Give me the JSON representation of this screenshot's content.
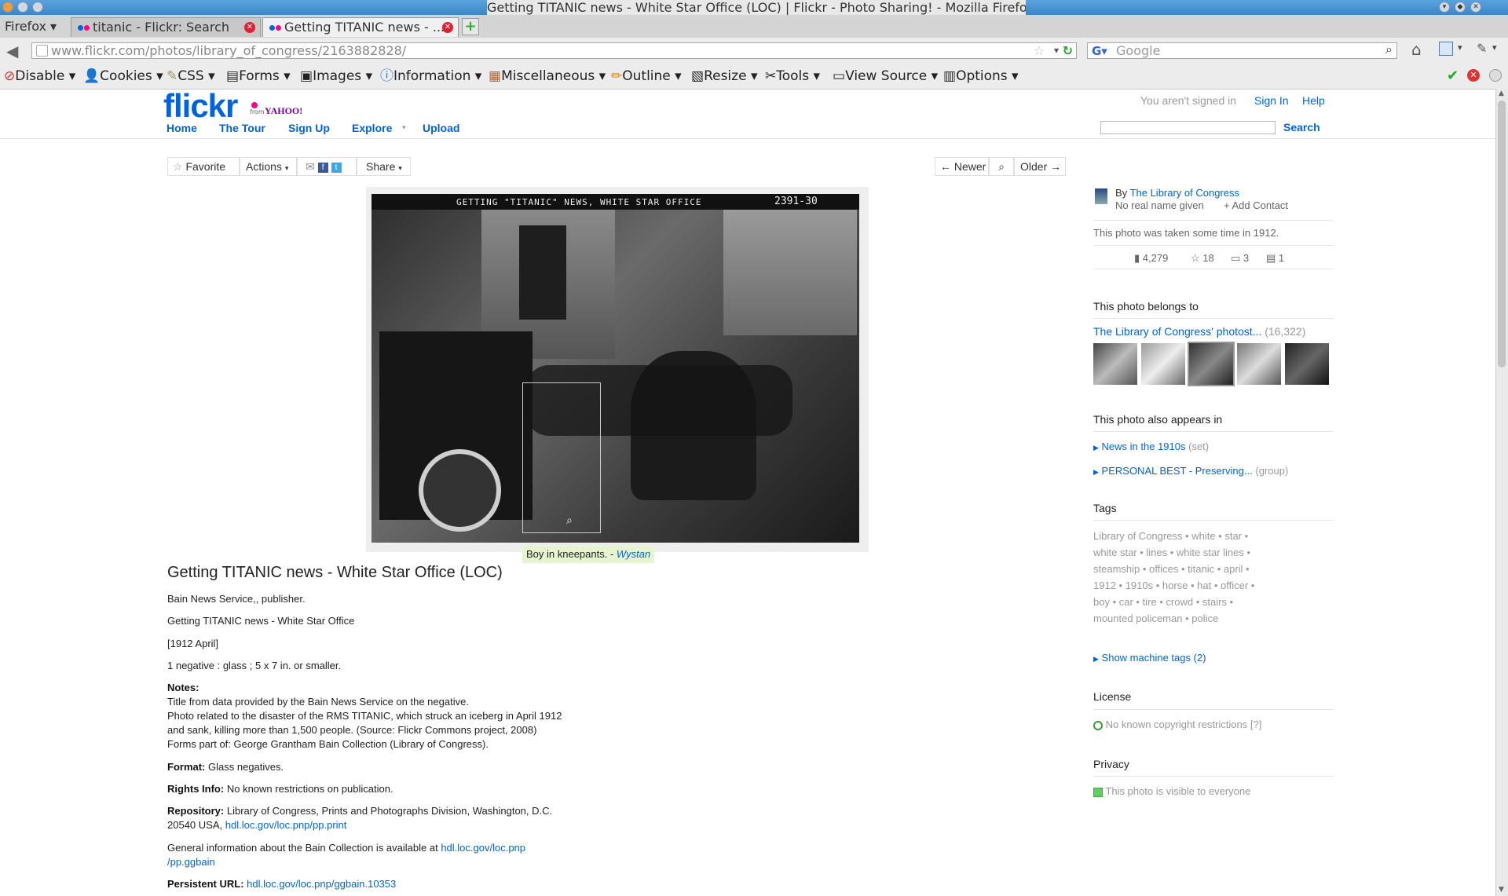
{
  "window": {
    "title": "Getting TITANIC news - White Star Office (LOC) | Flickr - Photo Sharing! - Mozilla Firefox"
  },
  "browser": {
    "menu_label": "Firefox",
    "tabs": [
      {
        "label": "titanic - Flickr: Search"
      },
      {
        "label": "Getting TITANIC news - ..."
      }
    ],
    "url": "www.flickr.com/photos/library_of_congress/2163882828/",
    "search_placeholder": "Google"
  },
  "dev_toolbar": {
    "items": [
      "Disable",
      "Cookies",
      "CSS",
      "Forms",
      "Images",
      "Information",
      "Miscellaneous",
      "Outline",
      "Resize",
      "Tools",
      "View Source",
      "Options"
    ]
  },
  "flickr_header": {
    "logo": "flickr",
    "logo_sub": "from",
    "logo_yahoo": "YAHOO!",
    "nav": [
      "Home",
      "The Tour",
      "Sign Up",
      "Explore",
      "Upload"
    ],
    "signin_note": "You aren't signed in",
    "sign_in": "Sign In",
    "help": "Help",
    "search_button": "Search"
  },
  "action_bar": {
    "favorite": "Favorite",
    "actions": "Actions",
    "share": "Share",
    "newer": "← Newer",
    "older": "Older →"
  },
  "photo": {
    "caption_top": "GETTING \"TITANIC\" NEWS, WHITE STAR OFFICE",
    "caption_num": "2391-30",
    "note_text": "Boy in kneepants. - ",
    "note_author": "Wystan"
  },
  "description": {
    "title": "Getting TITANIC news - White Star Office (LOC)",
    "line1": "Bain News Service,, publisher.",
    "line2": "Getting TITANIC news - White Star Office",
    "line3": "[1912 April]",
    "line4": "1 negative : glass ; 5 x 7 in. or smaller.",
    "notes_label": "Notes:",
    "notes": [
      "Title from data provided by the Bain News Service on the negative.",
      "Photo related to the disaster of the RMS TITANIC, which struck an iceberg in April 1912",
      "and sank, killing more than 1,500 people. (Source: Flickr Commons project, 2008)",
      "Forms part of: George Grantham Bain Collection (Library of Congress)."
    ],
    "format_label": "Format:",
    "format": "Glass negatives.",
    "rights_label": "Rights Info:",
    "rights": "No known restrictions on publication.",
    "repo_label": "Repository:",
    "repo_line1": "Library of Congress, Prints and Photographs Division, Washington, D.C.",
    "repo_line2": "20540 USA,",
    "repo_link": "hdl.loc.gov/loc.pnp/pp.print",
    "general_text": "General information about the Bain Collection is available at",
    "general_link1": "hdl.loc.gov/loc.pnp",
    "general_link2": "/pp.ggbain",
    "persistent_label": "Persistent URL:",
    "persistent_link": "hdl.loc.gov/loc.pnp/ggbain.10353"
  },
  "sidebar": {
    "by": "By",
    "owner": "The Library of Congress",
    "no_real_name": "No real name given",
    "add_contact": "+ Add Contact",
    "taken": "This photo was taken some time in 1912.",
    "stats": {
      "views": "4,279",
      "faves": "18",
      "comments": "3",
      "notes": "1"
    },
    "belongs_to": "This photo belongs to",
    "photostream": "The Library of Congress' photost...",
    "photostream_count": "(16,322)",
    "appears_in": "This photo also appears in",
    "set_name": "News in the 1910s",
    "set_type": "(set)",
    "group_name": "PERSONAL BEST - Preserving...",
    "group_type": "(group)",
    "tags_heading": "Tags",
    "tag_lines": [
      "Library of Congress  •  white  •  star  •",
      "white star  •  lines  •  white star lines  •",
      "steamship  •  offices  •  titanic  •  april  •",
      "1912  •  1910s  •  horse  •  hat  •  officer  •",
      "boy  •  car  •  tire  •  crowd  •  stairs  •",
      "mounted policeman  •  police"
    ],
    "machine_tags": "Show machine tags (2)",
    "license_heading": "License",
    "license": "No known copyright restrictions [?]",
    "privacy_heading": "Privacy",
    "privacy": "This photo is visible to everyone"
  }
}
